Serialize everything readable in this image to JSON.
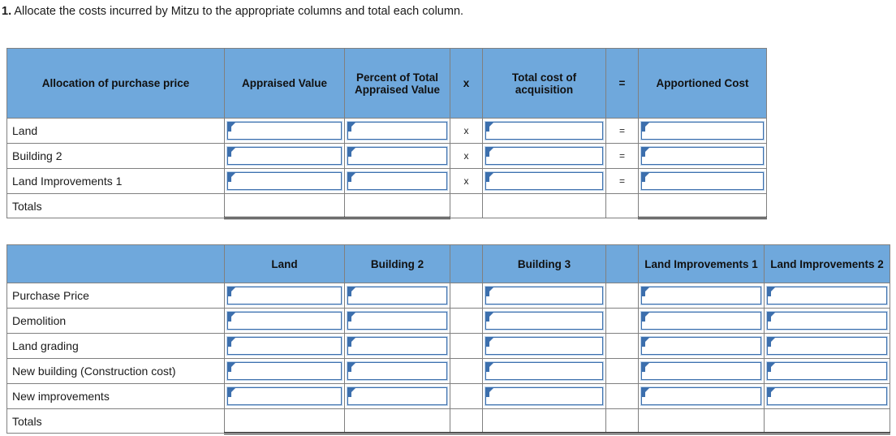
{
  "prompt": {
    "number": "1.",
    "text": "Allocate the costs incurred by Mitzu to the appropriate columns and total each column."
  },
  "colors": {
    "header_blue": "#6fa8dc",
    "input_border_blue": "#3c6fad",
    "grid_gray": "#808080",
    "rule_black": "#000000"
  },
  "allocation_table": {
    "headers": [
      "Allocation of purchase price",
      "Appraised Value",
      "Percent of Total Appraised Value",
      "x",
      "Total cost of acquisition",
      "=",
      "Apportioned Cost"
    ],
    "rows": [
      {
        "label": "Land",
        "appraised_value": "",
        "percent": "",
        "operator_x": "x",
        "total_cost": "",
        "operator_eq": "=",
        "apportioned_cost": ""
      },
      {
        "label": "Building 2",
        "appraised_value": "",
        "percent": "",
        "operator_x": "x",
        "total_cost": "",
        "operator_eq": "=",
        "apportioned_cost": ""
      },
      {
        "label": "Land Improvements 1",
        "appraised_value": "",
        "percent": "",
        "operator_x": "x",
        "total_cost": "",
        "operator_eq": "=",
        "apportioned_cost": ""
      }
    ],
    "totals": {
      "label": "Totals",
      "appraised_value": "",
      "percent": "",
      "total_cost": "",
      "apportioned_cost": ""
    }
  },
  "cost_table": {
    "headers": [
      "",
      "Land",
      "Building 2",
      "",
      "Building 3",
      "",
      "Land Improvements 1",
      "Land Improvements 2"
    ],
    "rows": [
      {
        "label": "Purchase Price",
        "land": "",
        "building_2": "",
        "building_3": "",
        "land_improvements_1": "",
        "land_improvements_2": ""
      },
      {
        "label": "Demolition",
        "land": "",
        "building_2": "",
        "building_3": "",
        "land_improvements_1": "",
        "land_improvements_2": ""
      },
      {
        "label": "Land grading",
        "land": "",
        "building_2": "",
        "building_3": "",
        "land_improvements_1": "",
        "land_improvements_2": ""
      },
      {
        "label": "New building (Construction cost)",
        "land": "",
        "building_2": "",
        "building_3": "",
        "land_improvements_1": "",
        "land_improvements_2": ""
      },
      {
        "label": "New improvements",
        "land": "",
        "building_2": "",
        "building_3": "",
        "land_improvements_1": "",
        "land_improvements_2": ""
      }
    ],
    "totals": {
      "label": "Totals",
      "land": "",
      "building_2": "",
      "building_3": "",
      "land_improvements_1": "",
      "land_improvements_2": ""
    }
  }
}
